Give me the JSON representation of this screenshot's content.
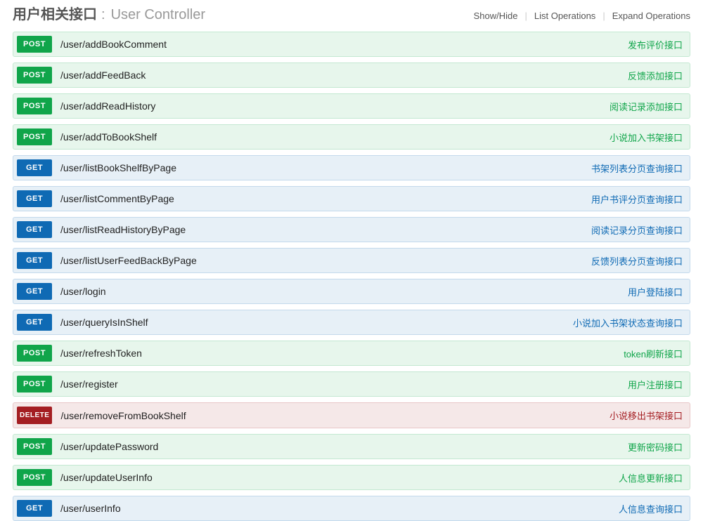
{
  "header": {
    "title_cn": "用户相关接口",
    "title_en": "User Controller",
    "show_hide": "Show/Hide",
    "list_ops": "List Operations",
    "expand_ops": "Expand Operations"
  },
  "operations": [
    {
      "method": "POST",
      "path": "/user/addBookComment",
      "desc": "发布评价接口"
    },
    {
      "method": "POST",
      "path": "/user/addFeedBack",
      "desc": "反馈添加接口"
    },
    {
      "method": "POST",
      "path": "/user/addReadHistory",
      "desc": "阅读记录添加接口"
    },
    {
      "method": "POST",
      "path": "/user/addToBookShelf",
      "desc": "小说加入书架接口"
    },
    {
      "method": "GET",
      "path": "/user/listBookShelfByPage",
      "desc": "书架列表分页查询接口"
    },
    {
      "method": "GET",
      "path": "/user/listCommentByPage",
      "desc": "用户书评分页查询接口"
    },
    {
      "method": "GET",
      "path": "/user/listReadHistoryByPage",
      "desc": "阅读记录分页查询接口"
    },
    {
      "method": "GET",
      "path": "/user/listUserFeedBackByPage",
      "desc": "反馈列表分页查询接口"
    },
    {
      "method": "GET",
      "path": "/user/login",
      "desc": "用户登陆接口"
    },
    {
      "method": "GET",
      "path": "/user/queryIsInShelf",
      "desc": "小说加入书架状态查询接口"
    },
    {
      "method": "POST",
      "path": "/user/refreshToken",
      "desc": "token刷新接口"
    },
    {
      "method": "POST",
      "path": "/user/register",
      "desc": "用户注册接口"
    },
    {
      "method": "DELETE",
      "path": "/user/removeFromBookShelf",
      "desc": "小说移出书架接口"
    },
    {
      "method": "POST",
      "path": "/user/updatePassword",
      "desc": "更新密码接口"
    },
    {
      "method": "POST",
      "path": "/user/updateUserInfo",
      "desc": "人信息更新接口"
    },
    {
      "method": "GET",
      "path": "/user/userInfo",
      "desc": "人信息查询接口"
    }
  ]
}
